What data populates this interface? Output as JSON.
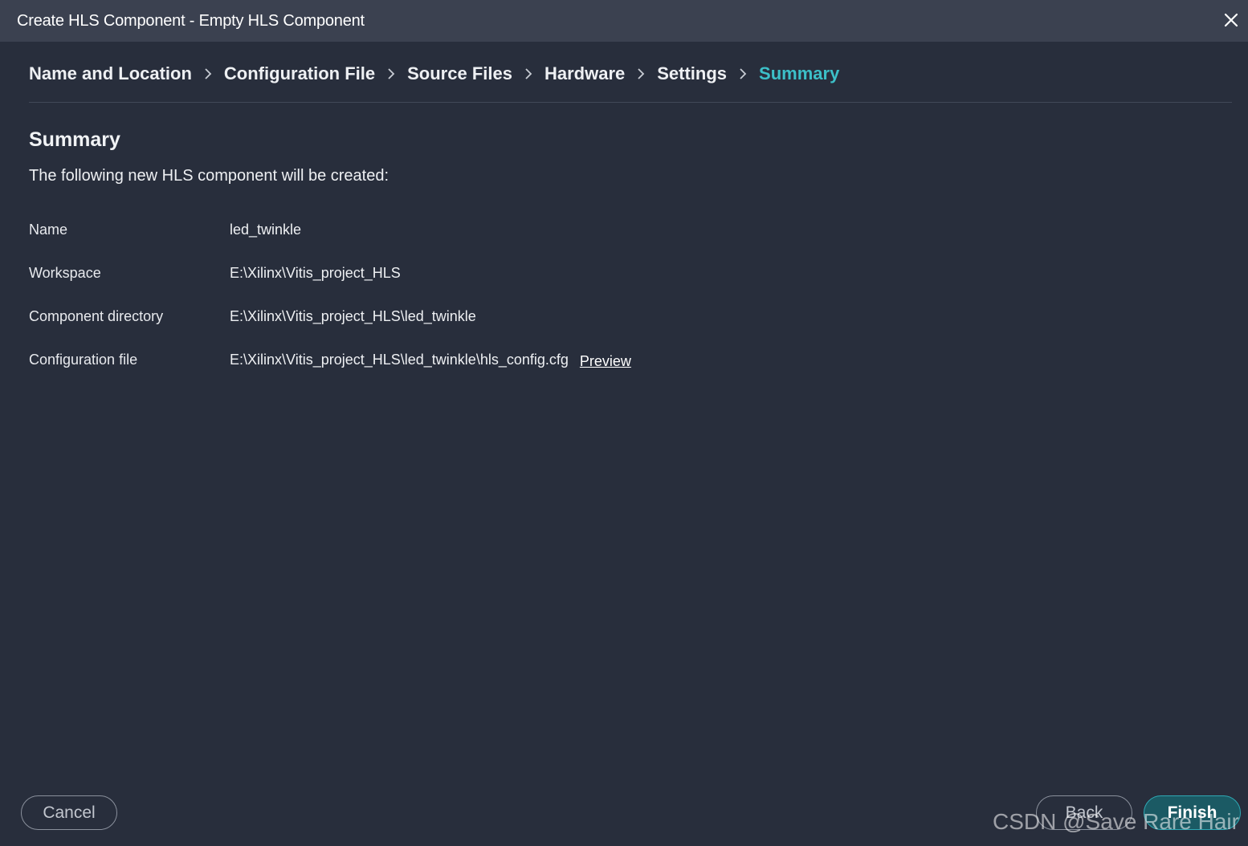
{
  "window": {
    "title": "Create HLS Component - Empty HLS Component",
    "close_icon": "close-icon"
  },
  "breadcrumb": {
    "steps": [
      {
        "label": "Name and Location",
        "active": false
      },
      {
        "label": "Configuration File",
        "active": false
      },
      {
        "label": "Source Files",
        "active": false
      },
      {
        "label": "Hardware",
        "active": false
      },
      {
        "label": "Settings",
        "active": false
      },
      {
        "label": "Summary",
        "active": true
      }
    ],
    "separator_icon": "chevron-right-icon"
  },
  "summary": {
    "title": "Summary",
    "intro": "The following new HLS component will be created:",
    "rows": [
      {
        "label": "Name",
        "value": "led_twinkle"
      },
      {
        "label": "Workspace",
        "value": "E:\\Xilinx\\Vitis_project_HLS"
      },
      {
        "label": "Component directory",
        "value": "E:\\Xilinx\\Vitis_project_HLS\\led_twinkle"
      },
      {
        "label": "Configuration file",
        "value": "E:\\Xilinx\\Vitis_project_HLS\\led_twinkle\\hls_config.cfg",
        "link": "Preview"
      }
    ]
  },
  "buttons": {
    "cancel": "Cancel",
    "back": "Back",
    "finish": "Finish"
  },
  "watermark": "CSDN @Save Rare Hair",
  "colors": {
    "background": "#282e3c",
    "titlebar": "#3b4150",
    "accent": "#3cc0c8",
    "finish_bg": "#1b5a64"
  }
}
